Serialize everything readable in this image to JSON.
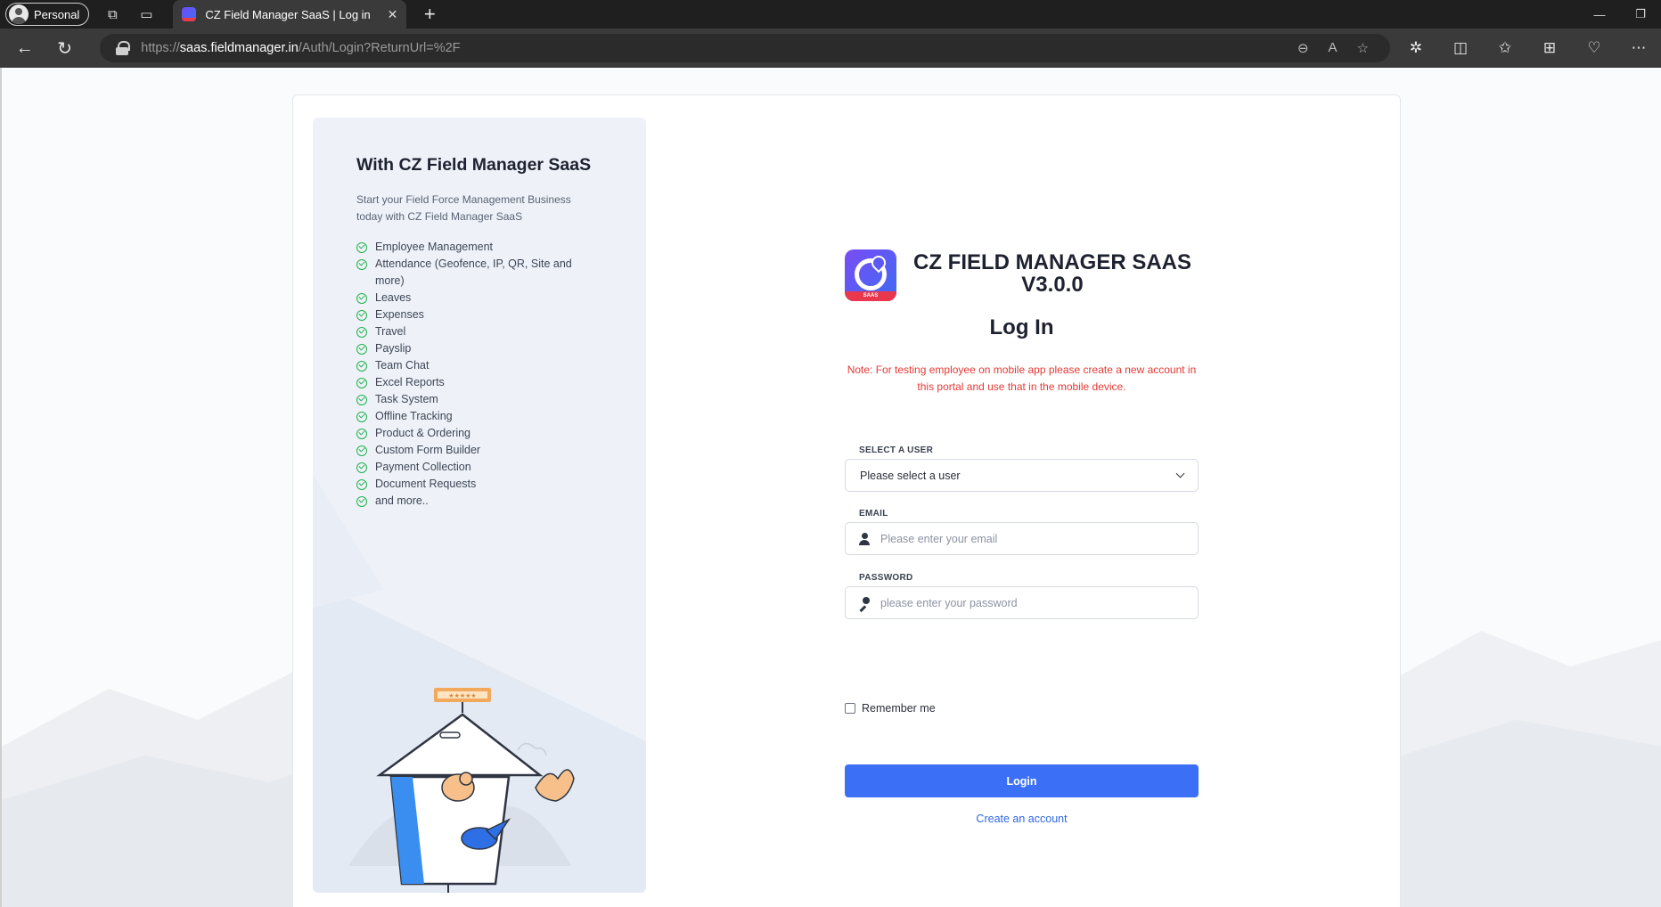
{
  "browser": {
    "profile_label": "Personal",
    "tab_title": "CZ Field Manager SaaS | Log in",
    "url_scheme": "https://",
    "url_host": "saas.fieldmanager.in",
    "url_path": "/Auth/Login?ReturnUrl=%2F"
  },
  "left_panel": {
    "title": "With CZ Field Manager SaaS",
    "subtitle": "Start your Field Force Management Business today with CZ Field Manager SaaS",
    "features": [
      "Employee Management",
      "Attendance (Geofence, IP, QR, Site and more)",
      "Leaves",
      "Expenses",
      "Travel",
      "Payslip",
      "Team Chat",
      "Excel Reports",
      "Task System",
      "Offline Tracking",
      "Product & Ordering",
      "Custom Form Builder",
      "Payment Collection",
      "Document Requests",
      "and more.."
    ]
  },
  "login": {
    "logo_badge": "SAAS",
    "brand_line1": "CZ FIELD MANAGER SAAS",
    "brand_line2": "V3.0.0",
    "title": "Log In",
    "note": "Note: For testing employee on mobile app please create a new account in this portal and use that in the mobile device.",
    "select_label": "SELECT A USER",
    "select_value": "Please select a user",
    "email_label": "EMAIL",
    "email_placeholder": "Please enter your email",
    "password_label": "PASSWORD",
    "password_placeholder": "please enter your password",
    "remember_label": "Remember me",
    "login_button": "Login",
    "create_account": "Create an account"
  },
  "colors": {
    "primary": "#3b70f6",
    "note_red": "#e53935",
    "check_green": "#22b14c",
    "panel_bg": "#eef2f8"
  }
}
